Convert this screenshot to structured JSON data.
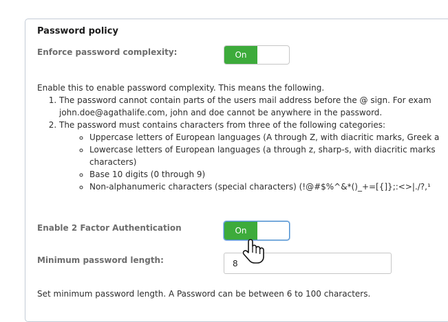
{
  "section": {
    "title": "Password policy"
  },
  "complexity": {
    "label": "Enforce password complexity:",
    "toggle_label": "On",
    "description": "Enable this to enable password complexity. This means the following.",
    "rules": [
      {
        "text": "The password cannot contain parts of the users mail address before the @ sign. For exam",
        "continuation": "john.doe@agathalife.com, john and doe cannot be anywhere in the password."
      },
      {
        "text": "The password must contains characters from three of the following categories:",
        "categories": [
          {
            "text": "Uppercase letters of European languages (A through Z, with diacritic marks, Greek a"
          },
          {
            "text": "Lowercase letters of European languages (a through z, sharp-s, with diacritic marks",
            "continuation": "characters)"
          },
          {
            "text": "Base 10 digits (0 through 9)"
          },
          {
            "text": "Non-alphanumeric characters (special characters) (!@#$%^&*()_+=[{]};:<>|./?,¹"
          }
        ]
      }
    ]
  },
  "two_factor": {
    "label": "Enable 2 Factor Authentication",
    "toggle_label": "On"
  },
  "min_length": {
    "label": "Minimum password length:",
    "value": "8",
    "description": "Set minimum password length. A Password can be between 6 to 100 characters."
  },
  "icons": {
    "cursor": "hand-pointer-icon"
  },
  "colors": {
    "toggle_on": "#3cab3c",
    "panel_border": "#c3ccd6",
    "focus_ring": "#4b8ed0"
  }
}
